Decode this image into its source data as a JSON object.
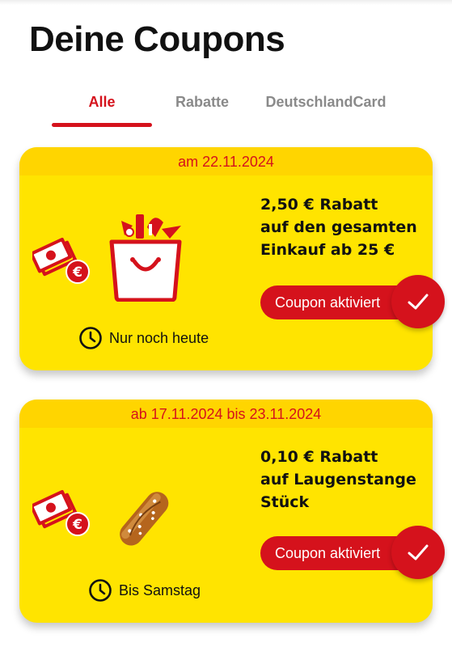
{
  "page": {
    "title": "Deine Coupons"
  },
  "tabs": [
    {
      "label": "Alle",
      "active": true
    },
    {
      "label": "Rabatte",
      "active": false
    },
    {
      "label": "DeutschlandCard",
      "active": false
    }
  ],
  "coupons": [
    {
      "validity": "am 22.11.2024",
      "text_lines": [
        "2,50 € Rabatt",
        "auf den gesamten",
        "Einkauf ab 25 €"
      ],
      "button_label": "Coupon aktiviert",
      "timer_label": "Nur noch heute",
      "product_icon": "shopping-bag-icon"
    },
    {
      "validity": "ab 17.11.2024 bis 23.11.2024",
      "text_lines": [
        "0,10 € Rabatt",
        "auf Laugenstange",
        "Stück"
      ],
      "button_label": "Coupon aktiviert",
      "timer_label": "Bis Samstag",
      "product_icon": "pretzel-stick-icon"
    }
  ],
  "colors": {
    "accent": "#d5121c",
    "card": "#ffe400",
    "card_header": "#ffd500",
    "inactive_tab": "#8a8a8a"
  }
}
